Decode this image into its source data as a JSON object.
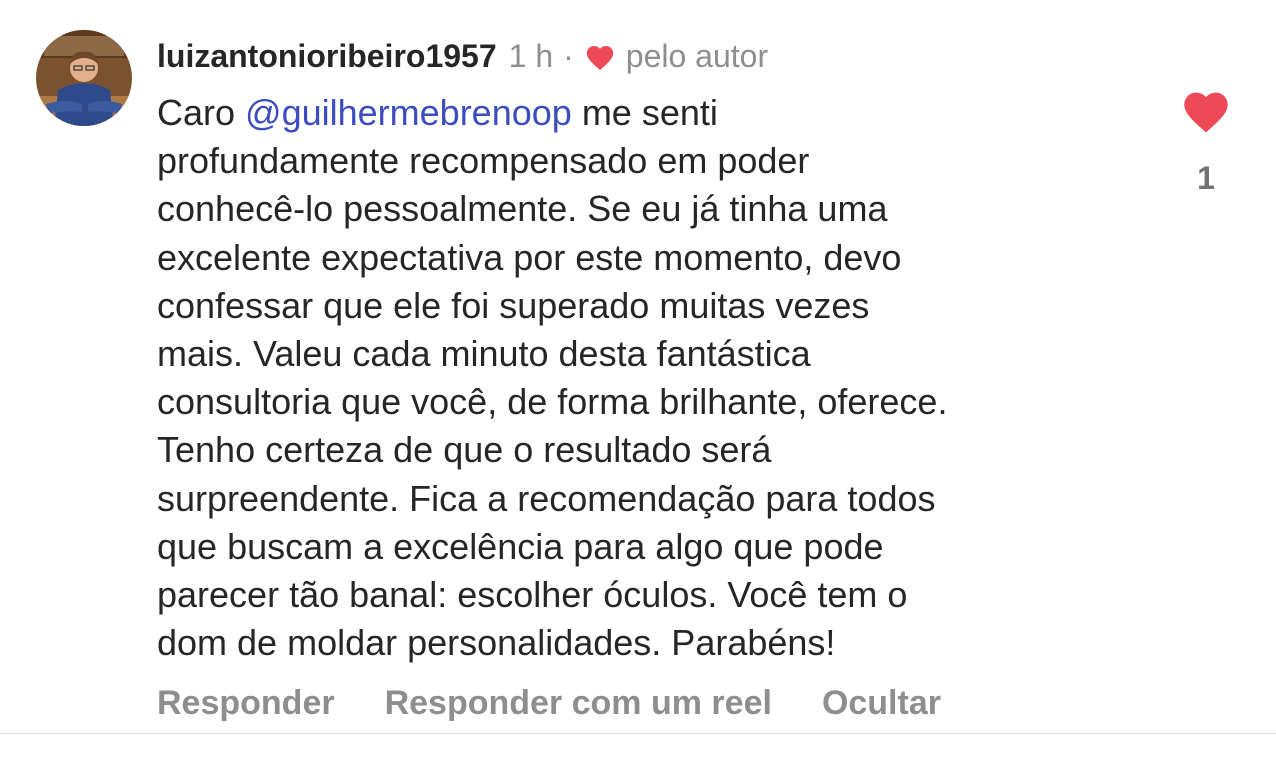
{
  "comment": {
    "username": "luizantonioribeiro1957",
    "time": "1 h",
    "separator": "·",
    "author_like_label": "pelo autor",
    "mention": "@guilhermebrenoop",
    "lines": [
      "Caro",
      "me senti",
      "profundamente recompensado em poder",
      "conhecê-lo pessoalmente. Se eu já tinha uma",
      "excelente expectativa por este momento, devo",
      "confessar que ele foi superado muitas vezes",
      "mais. Valeu cada minuto desta fantástica",
      "consultoria que você, de forma brilhante, oferece.",
      "Tenho certeza de que o resultado será",
      "surpreendente. Fica a recomendação para todos",
      "que buscam a excelência para algo que pode",
      "parecer tão banal: escolher óculos. Você tem o",
      "dom de moldar personalidades. Parabéns!"
    ],
    "like_count": "1",
    "actions": {
      "reply": "Responder",
      "reply_reel": "Responder com um reel",
      "hide": "Ocultar"
    }
  },
  "icons": {
    "author_heart": "heart-icon",
    "like": "heart-icon"
  },
  "colors": {
    "heart": "#ed4956",
    "mention": "#3b4dbf",
    "secondary_text": "#8e8e8e",
    "primary_text": "#262626"
  }
}
